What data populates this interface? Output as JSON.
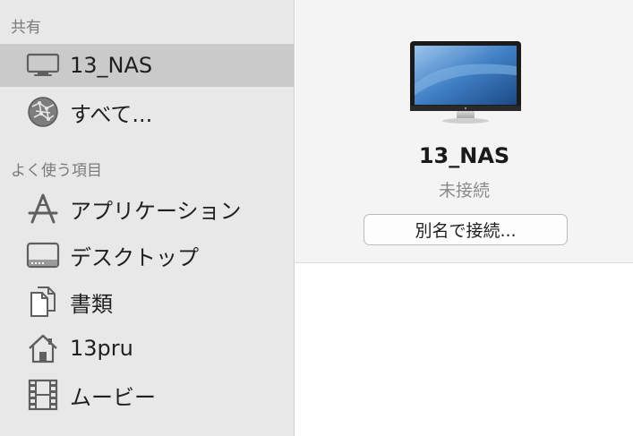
{
  "sidebar": {
    "shared_header": "共有",
    "shared_items": [
      {
        "label": "13_NAS",
        "icon": "monitor-icon"
      },
      {
        "label": "すべて...",
        "icon": "network-globe-icon"
      }
    ],
    "favorites_header": "よく使う項目",
    "favorite_items": [
      {
        "label": "アプリケーション",
        "icon": "applications-icon"
      },
      {
        "label": "デスクトップ",
        "icon": "desktop-icon"
      },
      {
        "label": "書類",
        "icon": "documents-icon"
      },
      {
        "label": "13pru",
        "icon": "home-icon"
      },
      {
        "label": "ムービー",
        "icon": "movies-icon"
      }
    ]
  },
  "detail": {
    "computer_name": "13_NAS",
    "status": "未接続",
    "connect_button_label": "別名で接続..."
  },
  "colors": {
    "sidebar_bg": "#e8e8e8",
    "selected_bg": "#cacaca",
    "panel_bg": "#f4f4f4",
    "icon_gray": "#5f5f5f"
  }
}
